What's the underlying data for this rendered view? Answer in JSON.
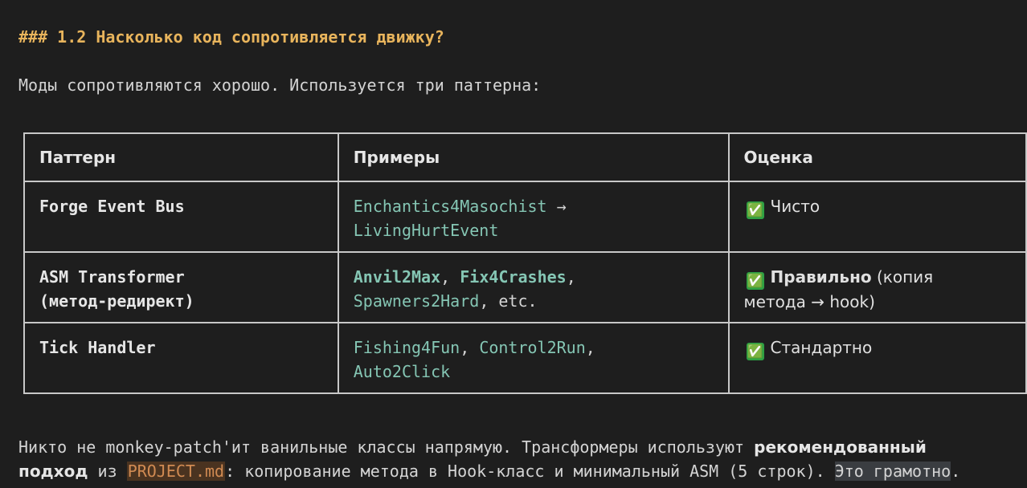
{
  "heading": "### 1.2 Насколько код сопротивляется движку?",
  "intro": "Моды сопротивляются хорошо. Используется три паттерна:",
  "table": {
    "headers": [
      "Паттерн",
      "Примеры",
      "Оценка"
    ],
    "rows": [
      {
        "pattern": "Forge Event Bus",
        "examples_a": "Enchantics4Masochist",
        "arrow": "→",
        "examples_b": "LivingHurtEvent",
        "check": "✅",
        "eval_text": "Чисто"
      },
      {
        "pattern_line1": "ASM Transformer",
        "pattern_line2": "(метод-редирект)",
        "ex1": "Anvil2Max",
        "sep1": ", ",
        "ex2": "Fix4Crashes",
        "sep2": ",",
        "ex3": "Spawners2Hard",
        "ex_tail": ", etc.",
        "check": "✅",
        "eval_bold": "Правильно",
        "eval_rest1": " (копия",
        "eval_rest2": "метода → hook)"
      },
      {
        "pattern": "Tick Handler",
        "ex1": "Fishing4Fun",
        "sep1": ", ",
        "ex2": "Control2Run",
        "sep2": ",",
        "ex3": "Auto2Click",
        "check": "✅",
        "eval_text": "Стандартно"
      }
    ]
  },
  "paragraph": {
    "p1": "Никто не monkey-patch'ит ванильные классы напрямую. Трансформеры используют ",
    "bold1": "рекомендованный",
    "bold2": "подход",
    "p2": " из ",
    "file": "PROJECT.md",
    "p3": ": копирование метода в Hook-класс и минимальный ASM (5 строк). ",
    "highlight": "Это грамотно",
    "p4": "."
  }
}
